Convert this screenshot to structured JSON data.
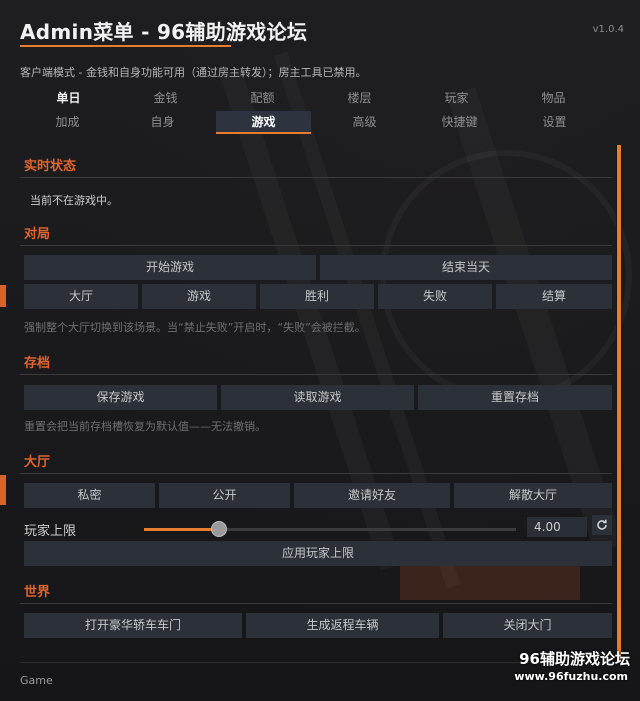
{
  "header": {
    "title": "Admin菜单 - 96辅助游戏论坛",
    "version": "v1.0.4",
    "subtitle": "客户端模式 - 金钱和自身功能可用（通过房主转发）；房主工具已禁用。"
  },
  "tabs": {
    "row1": [
      "单日",
      "金钱",
      "配额",
      "楼层",
      "玩家",
      "物品"
    ],
    "row2": [
      "加成",
      "自身",
      "游戏",
      "高级",
      "快捷键",
      "设置"
    ],
    "active": "游戏"
  },
  "status": {
    "title": "实时状态",
    "text": "当前不在游戏中。"
  },
  "round": {
    "title": "对局",
    "start_label": "开始游戏",
    "end_day_label": "结束当天",
    "scenes": [
      "大厅",
      "游戏",
      "胜利",
      "失败",
      "结算"
    ],
    "note": "强制整个大厅切换到该场景。当“禁止失败”开启时，“失败”会被拦截。"
  },
  "save": {
    "title": "存档",
    "save_label": "保存游戏",
    "load_label": "读取游戏",
    "reset_label": "重置存档",
    "note": "重置会把当前存档槽恢复为默认值——无法撤销。"
  },
  "lobby": {
    "title": "大厅",
    "private_label": "私密",
    "public_label": "公开",
    "invite_label": "邀请好友",
    "disband_label": "解散大厅",
    "player_limit_label": "玩家上限",
    "player_limit_value": "4.00",
    "player_limit_fraction": 0.2,
    "apply_label": "应用玩家上限"
  },
  "world": {
    "title": "世界",
    "open_car_door_label": "打开豪华轿车车门",
    "spawn_vehicle_label": "生成返程车辆",
    "close_door_label": "关闭大门"
  },
  "footer": {
    "label": "Game",
    "watermark_title": "96辅助游戏论坛",
    "watermark_url": "www.96fuzhu.com"
  },
  "colors": {
    "accent": "#e87d2e",
    "section_title": "#e0642c",
    "button_bg": "#2c3039"
  }
}
